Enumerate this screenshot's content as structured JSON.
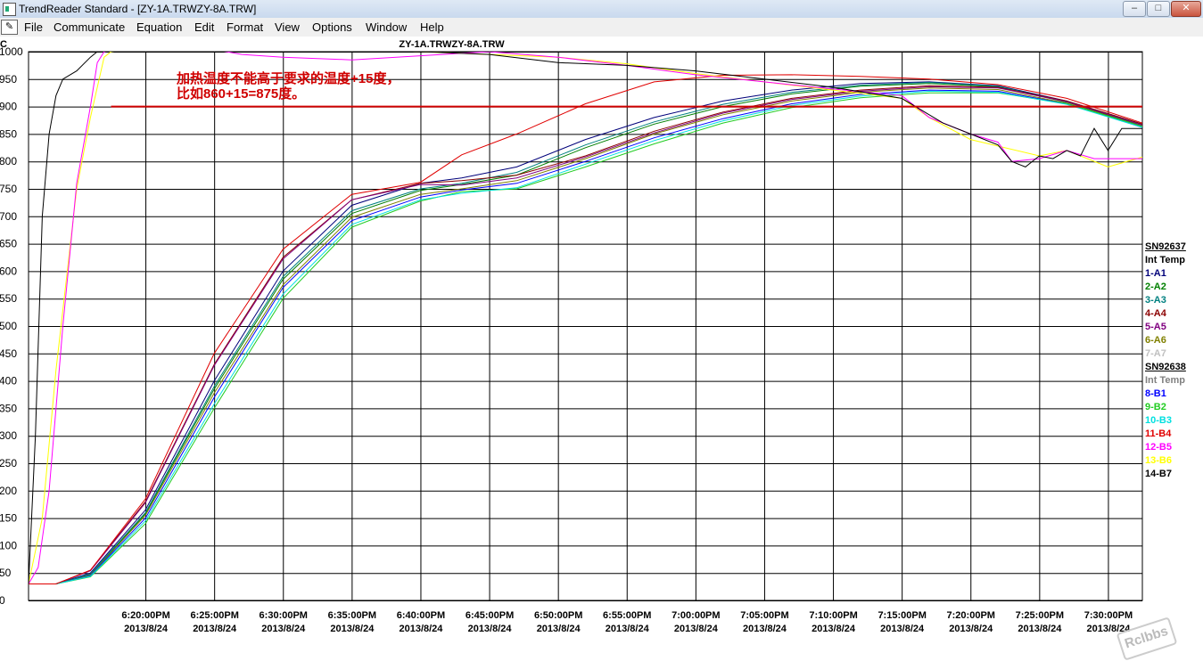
{
  "window": {
    "title": "TrendReader Standard - [ZY-1A.TRWZY-8A.TRW]",
    "buttons": [
      "–",
      "□",
      "✕"
    ]
  },
  "menu": [
    "File",
    "Communicate",
    "Equation",
    "Edit",
    "Format",
    "View",
    "Options",
    "Window",
    "Help"
  ],
  "mdi_buttons": [
    "–",
    "🗗",
    "✕"
  ],
  "chart_data": {
    "type": "line",
    "title": "ZY-1A.TRWZY-8A.TRW",
    "ylabel": "C",
    "ylim": [
      0,
      1000
    ],
    "y_ticks": [
      0,
      50,
      100,
      150,
      200,
      250,
      300,
      350,
      400,
      450,
      500,
      550,
      600,
      650,
      700,
      750,
      800,
      850,
      900,
      950,
      1000
    ],
    "x_unit": "minutes after 6:15PM",
    "xlim": [
      -3.5,
      77.5
    ],
    "x_ticks": [
      {
        "time": "6:20:00PM",
        "date": "2013/8/24"
      },
      {
        "time": "6:25:00PM",
        "date": "2013/8/24"
      },
      {
        "time": "6:30:00PM",
        "date": "2013/8/24"
      },
      {
        "time": "6:35:00PM",
        "date": "2013/8/24"
      },
      {
        "time": "6:40:00PM",
        "date": "2013/8/24"
      },
      {
        "time": "6:45:00PM",
        "date": "2013/8/24"
      },
      {
        "time": "6:50:00PM",
        "date": "2013/8/24"
      },
      {
        "time": "6:55:00PM",
        "date": "2013/8/24"
      },
      {
        "time": "7:00:00PM",
        "date": "2013/8/24"
      },
      {
        "time": "7:05:00PM",
        "date": "2013/8/24"
      },
      {
        "time": "7:10:00PM",
        "date": "2013/8/24"
      },
      {
        "time": "7:15:00PM",
        "date": "2013/8/24"
      },
      {
        "time": "7:20:00PM",
        "date": "2013/8/24"
      },
      {
        "time": "7:25:00PM",
        "date": "2013/8/24"
      },
      {
        "time": "7:30:00PM",
        "date": "2013/8/24"
      }
    ],
    "reference_line": {
      "y": 900,
      "color": "#d00000"
    },
    "annotation": [
      "加热温度不能高于要求的温度+15度，",
      "比如860+15=875度。"
    ],
    "annotation_color": "#d00000",
    "legend_groups": [
      {
        "header": "SN92637",
        "items": [
          {
            "name": "Int Temp",
            "color": "#000000"
          },
          {
            "name": "1-A1",
            "color": "#00007a"
          },
          {
            "name": "2-A2",
            "color": "#008000"
          },
          {
            "name": "3-A3",
            "color": "#008080"
          },
          {
            "name": "4-A4",
            "color": "#8b0000"
          },
          {
            "name": "5-A5",
            "color": "#800080"
          },
          {
            "name": "6-A6",
            "color": "#808000"
          },
          {
            "name": "7-A7",
            "color": "#c0c0c0"
          }
        ]
      },
      {
        "header": "SN92638",
        "items": [
          {
            "name": "Int Temp",
            "color": "#808080"
          },
          {
            "name": "8-B1",
            "color": "#0000ff"
          },
          {
            "name": "9-B2",
            "color": "#22cc22"
          },
          {
            "name": "10-B3",
            "color": "#00e0e0"
          },
          {
            "name": "11-B4",
            "color": "#e00000"
          },
          {
            "name": "12-B5",
            "color": "#ff00ff"
          },
          {
            "name": "13-B6",
            "color": "#ffff00"
          },
          {
            "name": "14-B7",
            "color": "#000000"
          }
        ]
      }
    ],
    "series": [
      {
        "name": "1-A1",
        "color": "#00007a",
        "x": [
          -3.5,
          -1.5,
          1,
          5,
          10,
          15,
          20,
          25,
          28,
          32,
          37,
          42,
          47,
          52,
          57,
          62,
          67,
          72,
          77.5
        ],
        "y": [
          30,
          30,
          50,
          165,
          400,
          600,
          720,
          760,
          770,
          790,
          840,
          880,
          910,
          930,
          942,
          945,
          938,
          910,
          868
        ]
      },
      {
        "name": "2-A2",
        "color": "#008000",
        "x": [
          -3.5,
          -1.5,
          1,
          5,
          10,
          15,
          20,
          25,
          28,
          32,
          37,
          42,
          47,
          52,
          57,
          62,
          67,
          72,
          77.5
        ],
        "y": [
          30,
          30,
          47,
          158,
          385,
          585,
          705,
          747,
          758,
          775,
          825,
          868,
          900,
          923,
          937,
          942,
          936,
          908,
          865
        ]
      },
      {
        "name": "3-A3",
        "color": "#008080",
        "x": [
          -3.5,
          -1.5,
          1,
          5,
          10,
          15,
          20,
          25,
          28,
          32,
          37,
          42,
          47,
          52,
          57,
          62,
          67,
          72,
          77.5
        ],
        "y": [
          30,
          30,
          48,
          160,
          390,
          590,
          710,
          750,
          760,
          780,
          830,
          872,
          904,
          926,
          939,
          944,
          937,
          909,
          866
        ]
      },
      {
        "name": "4-A4",
        "color": "#8b0000",
        "x": [
          -3.5,
          -1.5,
          1,
          5,
          10,
          15,
          20,
          25,
          28,
          32,
          37,
          42,
          47,
          52,
          57,
          62,
          67,
          72,
          77.5
        ],
        "y": [
          30,
          30,
          55,
          180,
          430,
          625,
          730,
          760,
          765,
          775,
          810,
          855,
          890,
          915,
          930,
          938,
          935,
          910,
          868
        ]
      },
      {
        "name": "5-A5",
        "color": "#800080",
        "x": [
          -3.5,
          -1.5,
          1,
          5,
          10,
          15,
          20,
          25,
          28,
          32,
          37,
          42,
          47,
          52,
          57,
          62,
          67,
          72,
          77.5
        ],
        "y": [
          30,
          30,
          54,
          178,
          428,
          622,
          730,
          758,
          757,
          770,
          808,
          852,
          888,
          913,
          928,
          936,
          934,
          909,
          866
        ]
      },
      {
        "name": "6-A6",
        "color": "#808000",
        "x": [
          -3.5,
          -1.5,
          1,
          5,
          10,
          15,
          20,
          25,
          28,
          32,
          37,
          42,
          47,
          52,
          57,
          62,
          67,
          72,
          77.5
        ],
        "y": [
          30,
          30,
          46,
          155,
          378,
          575,
          698,
          740,
          750,
          765,
          805,
          850,
          885,
          910,
          926,
          934,
          931,
          906,
          864
        ]
      },
      {
        "name": "8-B1",
        "color": "#0000ff",
        "x": [
          -3.5,
          -1.5,
          1,
          5,
          10,
          15,
          20,
          25,
          28,
          32,
          37,
          42,
          47,
          52,
          57,
          62,
          67,
          72,
          77.5
        ],
        "y": [
          30,
          30,
          45,
          150,
          370,
          570,
          692,
          735,
          748,
          760,
          800,
          843,
          878,
          905,
          922,
          930,
          928,
          905,
          862
        ]
      },
      {
        "name": "9-B2",
        "color": "#22cc22",
        "x": [
          -3.5,
          -1.5,
          1,
          5,
          10,
          15,
          20,
          25,
          28,
          32,
          37,
          42,
          47,
          52,
          57,
          62,
          67,
          72,
          77.5
        ],
        "y": [
          30,
          30,
          43,
          140,
          350,
          550,
          680,
          728,
          745,
          750,
          790,
          832,
          870,
          898,
          916,
          925,
          925,
          905,
          864
        ]
      },
      {
        "name": "10-B3",
        "color": "#00e0e0",
        "x": [
          -3.5,
          -1.5,
          1,
          5,
          10,
          15,
          20,
          25,
          28,
          32,
          37,
          42,
          47,
          52,
          57,
          62,
          67,
          72,
          77.5
        ],
        "y": [
          30,
          30,
          44,
          145,
          358,
          558,
          685,
          730,
          742,
          752,
          795,
          838,
          874,
          902,
          919,
          928,
          926,
          904,
          862
        ]
      },
      {
        "name": "11-B4",
        "color": "#e00000",
        "x": [
          -3.5,
          -1.5,
          1,
          5,
          10,
          15,
          20,
          25,
          28,
          32,
          37,
          42,
          47,
          52,
          57,
          62,
          67,
          72,
          77.5
        ],
        "y": [
          30,
          30,
          55,
          185,
          450,
          640,
          740,
          762,
          812,
          850,
          905,
          945,
          957,
          958,
          955,
          950,
          940,
          915,
          870
        ]
      },
      {
        "name": "13-B6",
        "color": "#ffff00",
        "x": [
          -3.5,
          -2.5,
          -1.5,
          0,
          1,
          2,
          2.5,
          4,
          10,
          15,
          20,
          25,
          30,
          35,
          40,
          45,
          50,
          55,
          60,
          62,
          65,
          70,
          72,
          75,
          77.5
        ],
        "y": [
          30,
          150,
          420,
          750,
          880,
          990,
          1000,
          1005,
          1008,
          1010,
          1007,
          1000,
          995,
          990,
          978,
          960,
          945,
          930,
          915,
          880,
          840,
          810,
          820,
          790,
          808
        ]
      },
      {
        "name": "12-B5",
        "color": "#ff00ff",
        "x": [
          -3.5,
          -2.8,
          -2,
          -1,
          0,
          1,
          1.5,
          2,
          3,
          10,
          12,
          15,
          20,
          30,
          35,
          40,
          45,
          50,
          55,
          60,
          62,
          65,
          67,
          68,
          70,
          72,
          74,
          75,
          77.5
        ],
        "y": [
          30,
          60,
          200,
          500,
          760,
          900,
          980,
          1000,
          1004,
          1004,
          995,
          990,
          985,
          1000,
          990,
          975,
          958,
          945,
          932,
          920,
          880,
          850,
          835,
          800,
          805,
          820,
          805,
          805,
          805
        ]
      },
      {
        "name": "14-B7",
        "color": "#000000",
        "x": [
          -3.5,
          -3,
          -2.5,
          -2,
          -1.5,
          -1,
          0,
          1,
          1.5,
          2,
          5,
          10,
          20,
          25,
          30,
          35,
          40,
          45,
          50,
          55,
          60,
          61,
          63,
          65,
          67,
          68,
          69,
          70,
          71,
          72,
          73,
          74,
          75,
          76,
          77.5
        ],
        "y": [
          30,
          300,
          700,
          850,
          920,
          950,
          965,
          990,
          1000,
          1002,
          1008,
          1010,
          1005,
          1000,
          995,
          980,
          975,
          965,
          950,
          935,
          915,
          900,
          870,
          850,
          830,
          800,
          790,
          810,
          805,
          820,
          810,
          860,
          820,
          860,
          860
        ]
      }
    ]
  }
}
